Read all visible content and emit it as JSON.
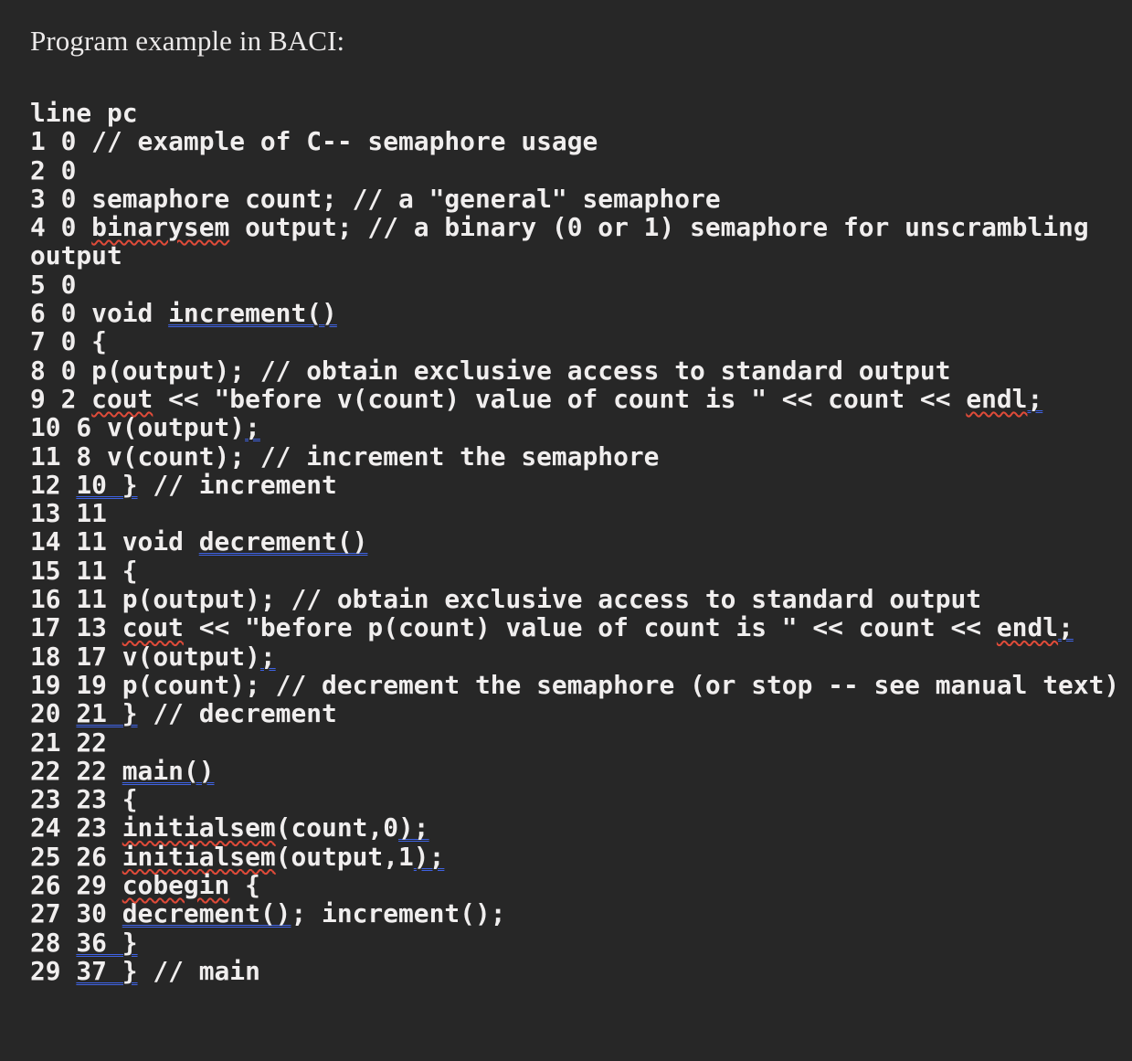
{
  "colors": {
    "background": "#272727",
    "text": "#f0eeee",
    "heading_text": "#eceaea",
    "spelling_underline": "#e04b39",
    "grammar_underline": "#3f63e4"
  },
  "heading": "Program example in BACI:",
  "listing": {
    "header": "line pc",
    "lines": [
      {
        "id": "header-row",
        "runs": [
          {
            "t": "line pc",
            "mark": "none"
          }
        ]
      },
      {
        "id": "line-1",
        "runs": [
          {
            "t": "1 0 // example of C-- semaphore usage",
            "mark": "none"
          }
        ]
      },
      {
        "id": "line-2",
        "runs": [
          {
            "t": "2 0",
            "mark": "none"
          }
        ]
      },
      {
        "id": "line-3",
        "runs": [
          {
            "t": "3 0 semaphore count; // a \"general\" semaphore",
            "mark": "none"
          }
        ]
      },
      {
        "id": "line-4",
        "runs": [
          {
            "t": "4 0 ",
            "mark": "none"
          },
          {
            "t": "binarysem",
            "mark": "spelling"
          },
          {
            "t": " output; // a binary (0 or 1) semaphore for unscrambling output",
            "mark": "none"
          }
        ]
      },
      {
        "id": "line-5",
        "runs": [
          {
            "t": "5 0",
            "mark": "none"
          }
        ]
      },
      {
        "id": "line-6",
        "runs": [
          {
            "t": "6 0 void ",
            "mark": "none"
          },
          {
            "t": "increment()",
            "mark": "grammar"
          }
        ]
      },
      {
        "id": "line-7",
        "runs": [
          {
            "t": "7 0 {",
            "mark": "none"
          }
        ]
      },
      {
        "id": "line-8",
        "runs": [
          {
            "t": "8 0 p(output); // obtain exclusive access to standard output",
            "mark": "none"
          }
        ]
      },
      {
        "id": "line-9",
        "runs": [
          {
            "t": "9 2 ",
            "mark": "none"
          },
          {
            "t": "cout",
            "mark": "spelling"
          },
          {
            "t": " << \"before v(count) value of count is \" << count << ",
            "mark": "none"
          },
          {
            "t": "endl",
            "mark": "spelling"
          },
          {
            "t": ";",
            "mark": "grammar"
          }
        ]
      },
      {
        "id": "line-10",
        "runs": [
          {
            "t": "10 6 v(output)",
            "mark": "none"
          },
          {
            "t": ";",
            "mark": "grammar"
          }
        ]
      },
      {
        "id": "line-11",
        "runs": [
          {
            "t": "11 8 v(count); // increment the semaphore",
            "mark": "none"
          }
        ]
      },
      {
        "id": "line-12",
        "runs": [
          {
            "t": "12 ",
            "mark": "none"
          },
          {
            "t": "10 }",
            "mark": "grammar"
          },
          {
            "t": " // increment",
            "mark": "none"
          }
        ]
      },
      {
        "id": "line-13",
        "runs": [
          {
            "t": "13 11",
            "mark": "none"
          }
        ]
      },
      {
        "id": "line-14",
        "runs": [
          {
            "t": "14 11 void ",
            "mark": "none"
          },
          {
            "t": "decrement()",
            "mark": "grammar"
          }
        ]
      },
      {
        "id": "line-15",
        "runs": [
          {
            "t": "15 11 {",
            "mark": "none"
          }
        ]
      },
      {
        "id": "line-16",
        "runs": [
          {
            "t": "16 11 p(output); // obtain exclusive access to standard output",
            "mark": "none"
          }
        ]
      },
      {
        "id": "line-17",
        "runs": [
          {
            "t": "17 13 ",
            "mark": "none"
          },
          {
            "t": "cout",
            "mark": "spelling"
          },
          {
            "t": " << \"before p(count) value of count is \" << count << ",
            "mark": "none"
          },
          {
            "t": "endl",
            "mark": "spelling"
          },
          {
            "t": ";",
            "mark": "grammar"
          }
        ]
      },
      {
        "id": "line-18",
        "runs": [
          {
            "t": "18 17 v(output)",
            "mark": "none"
          },
          {
            "t": ";",
            "mark": "grammar"
          }
        ]
      },
      {
        "id": "line-19",
        "runs": [
          {
            "t": "19 19 p(count); // decrement the semaphore (or stop -- see manual text)",
            "mark": "none"
          }
        ]
      },
      {
        "id": "line-20",
        "runs": [
          {
            "t": "20 ",
            "mark": "none"
          },
          {
            "t": "21 }",
            "mark": "grammar"
          },
          {
            "t": " // decrement",
            "mark": "none"
          }
        ]
      },
      {
        "id": "line-21",
        "runs": [
          {
            "t": "21 22",
            "mark": "none"
          }
        ]
      },
      {
        "id": "line-22",
        "runs": [
          {
            "t": "22 22 ",
            "mark": "none"
          },
          {
            "t": "main()",
            "mark": "grammar"
          }
        ]
      },
      {
        "id": "line-23",
        "runs": [
          {
            "t": "23 23 {",
            "mark": "none"
          }
        ]
      },
      {
        "id": "line-24",
        "runs": [
          {
            "t": "24 23 ",
            "mark": "none"
          },
          {
            "t": "initialsem",
            "mark": "spelling"
          },
          {
            "t": "(count,0",
            "mark": "none"
          },
          {
            "t": ");",
            "mark": "grammar"
          }
        ]
      },
      {
        "id": "line-25",
        "runs": [
          {
            "t": "25 26 ",
            "mark": "none"
          },
          {
            "t": "initialsem",
            "mark": "spelling"
          },
          {
            "t": "(output,1",
            "mark": "none"
          },
          {
            "t": ");",
            "mark": "grammar"
          }
        ]
      },
      {
        "id": "line-26",
        "runs": [
          {
            "t": "26 29 ",
            "mark": "none"
          },
          {
            "t": "cobegin",
            "mark": "spelling"
          },
          {
            "t": " {",
            "mark": "none"
          }
        ]
      },
      {
        "id": "line-27",
        "runs": [
          {
            "t": "27 30 ",
            "mark": "none"
          },
          {
            "t": "decrement()",
            "mark": "grammar"
          },
          {
            "t": "; increment();",
            "mark": "none"
          }
        ]
      },
      {
        "id": "line-28",
        "runs": [
          {
            "t": "28 ",
            "mark": "none"
          },
          {
            "t": "36 }",
            "mark": "grammar"
          }
        ]
      },
      {
        "id": "line-29",
        "runs": [
          {
            "t": "29 ",
            "mark": "none"
          },
          {
            "t": "37 }",
            "mark": "grammar"
          },
          {
            "t": " // main",
            "mark": "none"
          }
        ]
      }
    ]
  }
}
